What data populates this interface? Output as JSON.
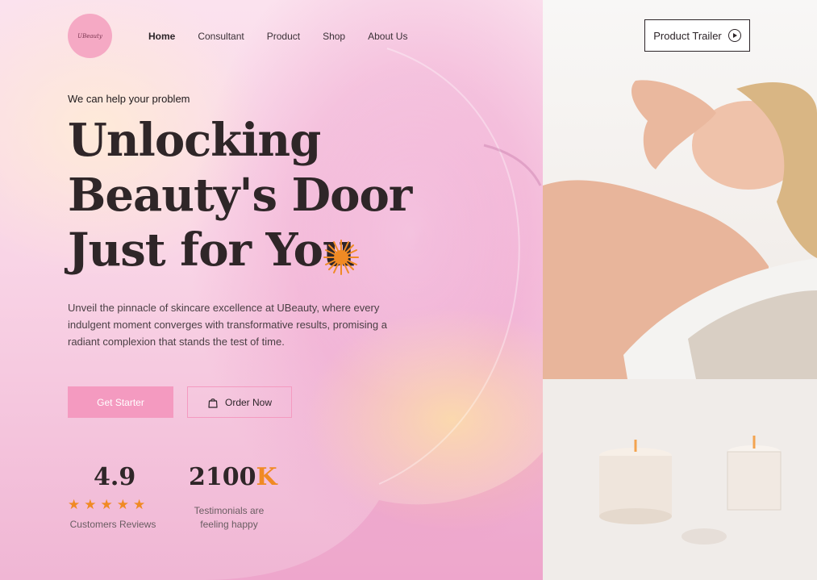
{
  "brand": {
    "logo_text": "UBeauty"
  },
  "nav": {
    "items": [
      {
        "label": "Home",
        "active": true
      },
      {
        "label": "Consultant"
      },
      {
        "label": "Product"
      },
      {
        "label": "Shop"
      },
      {
        "label": "About Us"
      }
    ]
  },
  "header": {
    "trailer_label": "Product Trailer",
    "trailer_icon": "play-circle-icon"
  },
  "hero": {
    "tagline": "We can help your problem",
    "headline_line1": "Unlocking",
    "headline_line2": "Beauty's Door",
    "headline_line3": "Just for You",
    "sparkle_icon": "sparkle-icon",
    "description": "Unveil the pinnacle of skincare excellence at UBeauty, where every indulgent moment converges with transformative results, promising a radiant complexion that stands the test of time.",
    "primary_button": "Get Starter",
    "secondary_button": "Order Now",
    "secondary_icon": "shopping-bag-icon"
  },
  "stats": {
    "rating_value": "4.9",
    "rating_stars": 5,
    "rating_label": "Customers Reviews",
    "testimonials_value": "2100",
    "testimonials_suffix": "K",
    "testimonials_label_line1": "Testimonials are",
    "testimonials_label_line2": "feeling happy"
  },
  "colors": {
    "accent_pink": "#f49ac0",
    "accent_orange": "#f08a24",
    "text_dark": "#2f2628"
  }
}
